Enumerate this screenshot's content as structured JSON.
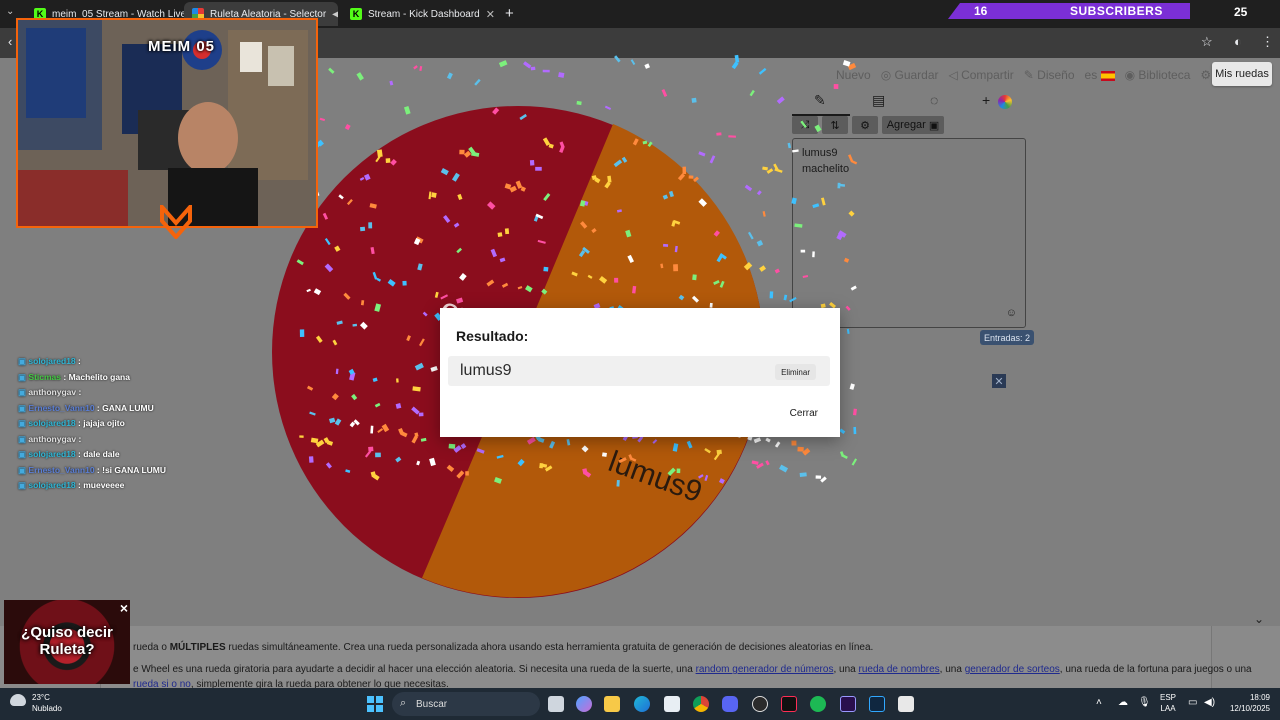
{
  "browser": {
    "tabs": [
      {
        "title": "meim_05 Stream - Watch Live o",
        "favicon": "kick-icon",
        "active": false
      },
      {
        "title": "Ruleta Aleatoria - Selector",
        "favicon": "wheel-icon",
        "active": true
      },
      {
        "title": "Stream - Kick Dashboard",
        "favicon": "kick-icon",
        "active": false
      }
    ],
    "new_tab": "+"
  },
  "stream_overlay": {
    "channel_name": "MEIM 05",
    "subscribers_count": "16",
    "subscribers_label": "SUBSCRIBERS",
    "subscribers_goal": "25",
    "chat": [
      {
        "user": "solojared18",
        "msg": ""
      },
      {
        "user": "Sticmas",
        "msg": "Machelito gana"
      },
      {
        "user": "anthonygav",
        "msg": ""
      },
      {
        "user": "Ernesto_Vann10",
        "msg": "GANA LUMU"
      },
      {
        "user": "solojared18",
        "msg": "jajaja ojito"
      },
      {
        "user": "anthonygav",
        "msg": ""
      },
      {
        "user": "solojared18",
        "msg": "dale dale"
      },
      {
        "user": "Ernesto_Vann10",
        "msg": "!si GANA LUMU"
      },
      {
        "user": "solojared18",
        "msg": "mueveeee"
      }
    ],
    "promo": {
      "line1": "¿Quiso decir",
      "line2": "Ruleta?",
      "close": "×"
    }
  },
  "wheel_app": {
    "toolbar": {
      "new": "Nuevo",
      "save": "Guardar",
      "share": "Compartir",
      "design": "Diseño",
      "language": "es",
      "library": "Biblioteca",
      "my_wheels": "Mis ruedas"
    },
    "side_buttons": {
      "add": "Agregar"
    },
    "entries": [
      "lumus9",
      "machelito"
    ],
    "entries_count": "Entradas: 2",
    "wheel_labels": [
      "machelito",
      "lumus9"
    ],
    "colors": {
      "slice1": "#8b0d1d",
      "slice2": "#b2590a"
    }
  },
  "result_modal": {
    "title": "Resultado:",
    "winner": "lumus9",
    "delete": "Eliminar",
    "close": "Cerrar"
  },
  "info_text": {
    "line1_prefix": "rueda o ",
    "line1_bold": "MÚLTIPLES",
    "line1_rest": " ruedas simultáneamente. Crea una rueda personalizada ahora usando esta herramienta gratuita de generación de decisiones aleatorias en línea.",
    "line2_prefix": "e Wheel es una rueda giratoria para ayudarte a decidir al hacer una elección aleatoria. Si necesita una rueda de la suerte, una ",
    "link1": "random generador de números",
    "mid1": ", una ",
    "link2": "rueda de nombres",
    "mid2": ", una ",
    "link3": "generador de sorteos",
    "line2_rest": ", una rueda de la fortuna para juegos o una",
    "line3_link": "rueda si o no",
    "line3_rest": ", simplemente gira la rueda para obtener lo que necesitas."
  },
  "taskbar": {
    "temperature": "23°C",
    "weather": "Nublado",
    "search": "Buscar",
    "lang1": "ESP",
    "lang2": "LAA",
    "time": "18:09",
    "date": "12/10/2025"
  }
}
